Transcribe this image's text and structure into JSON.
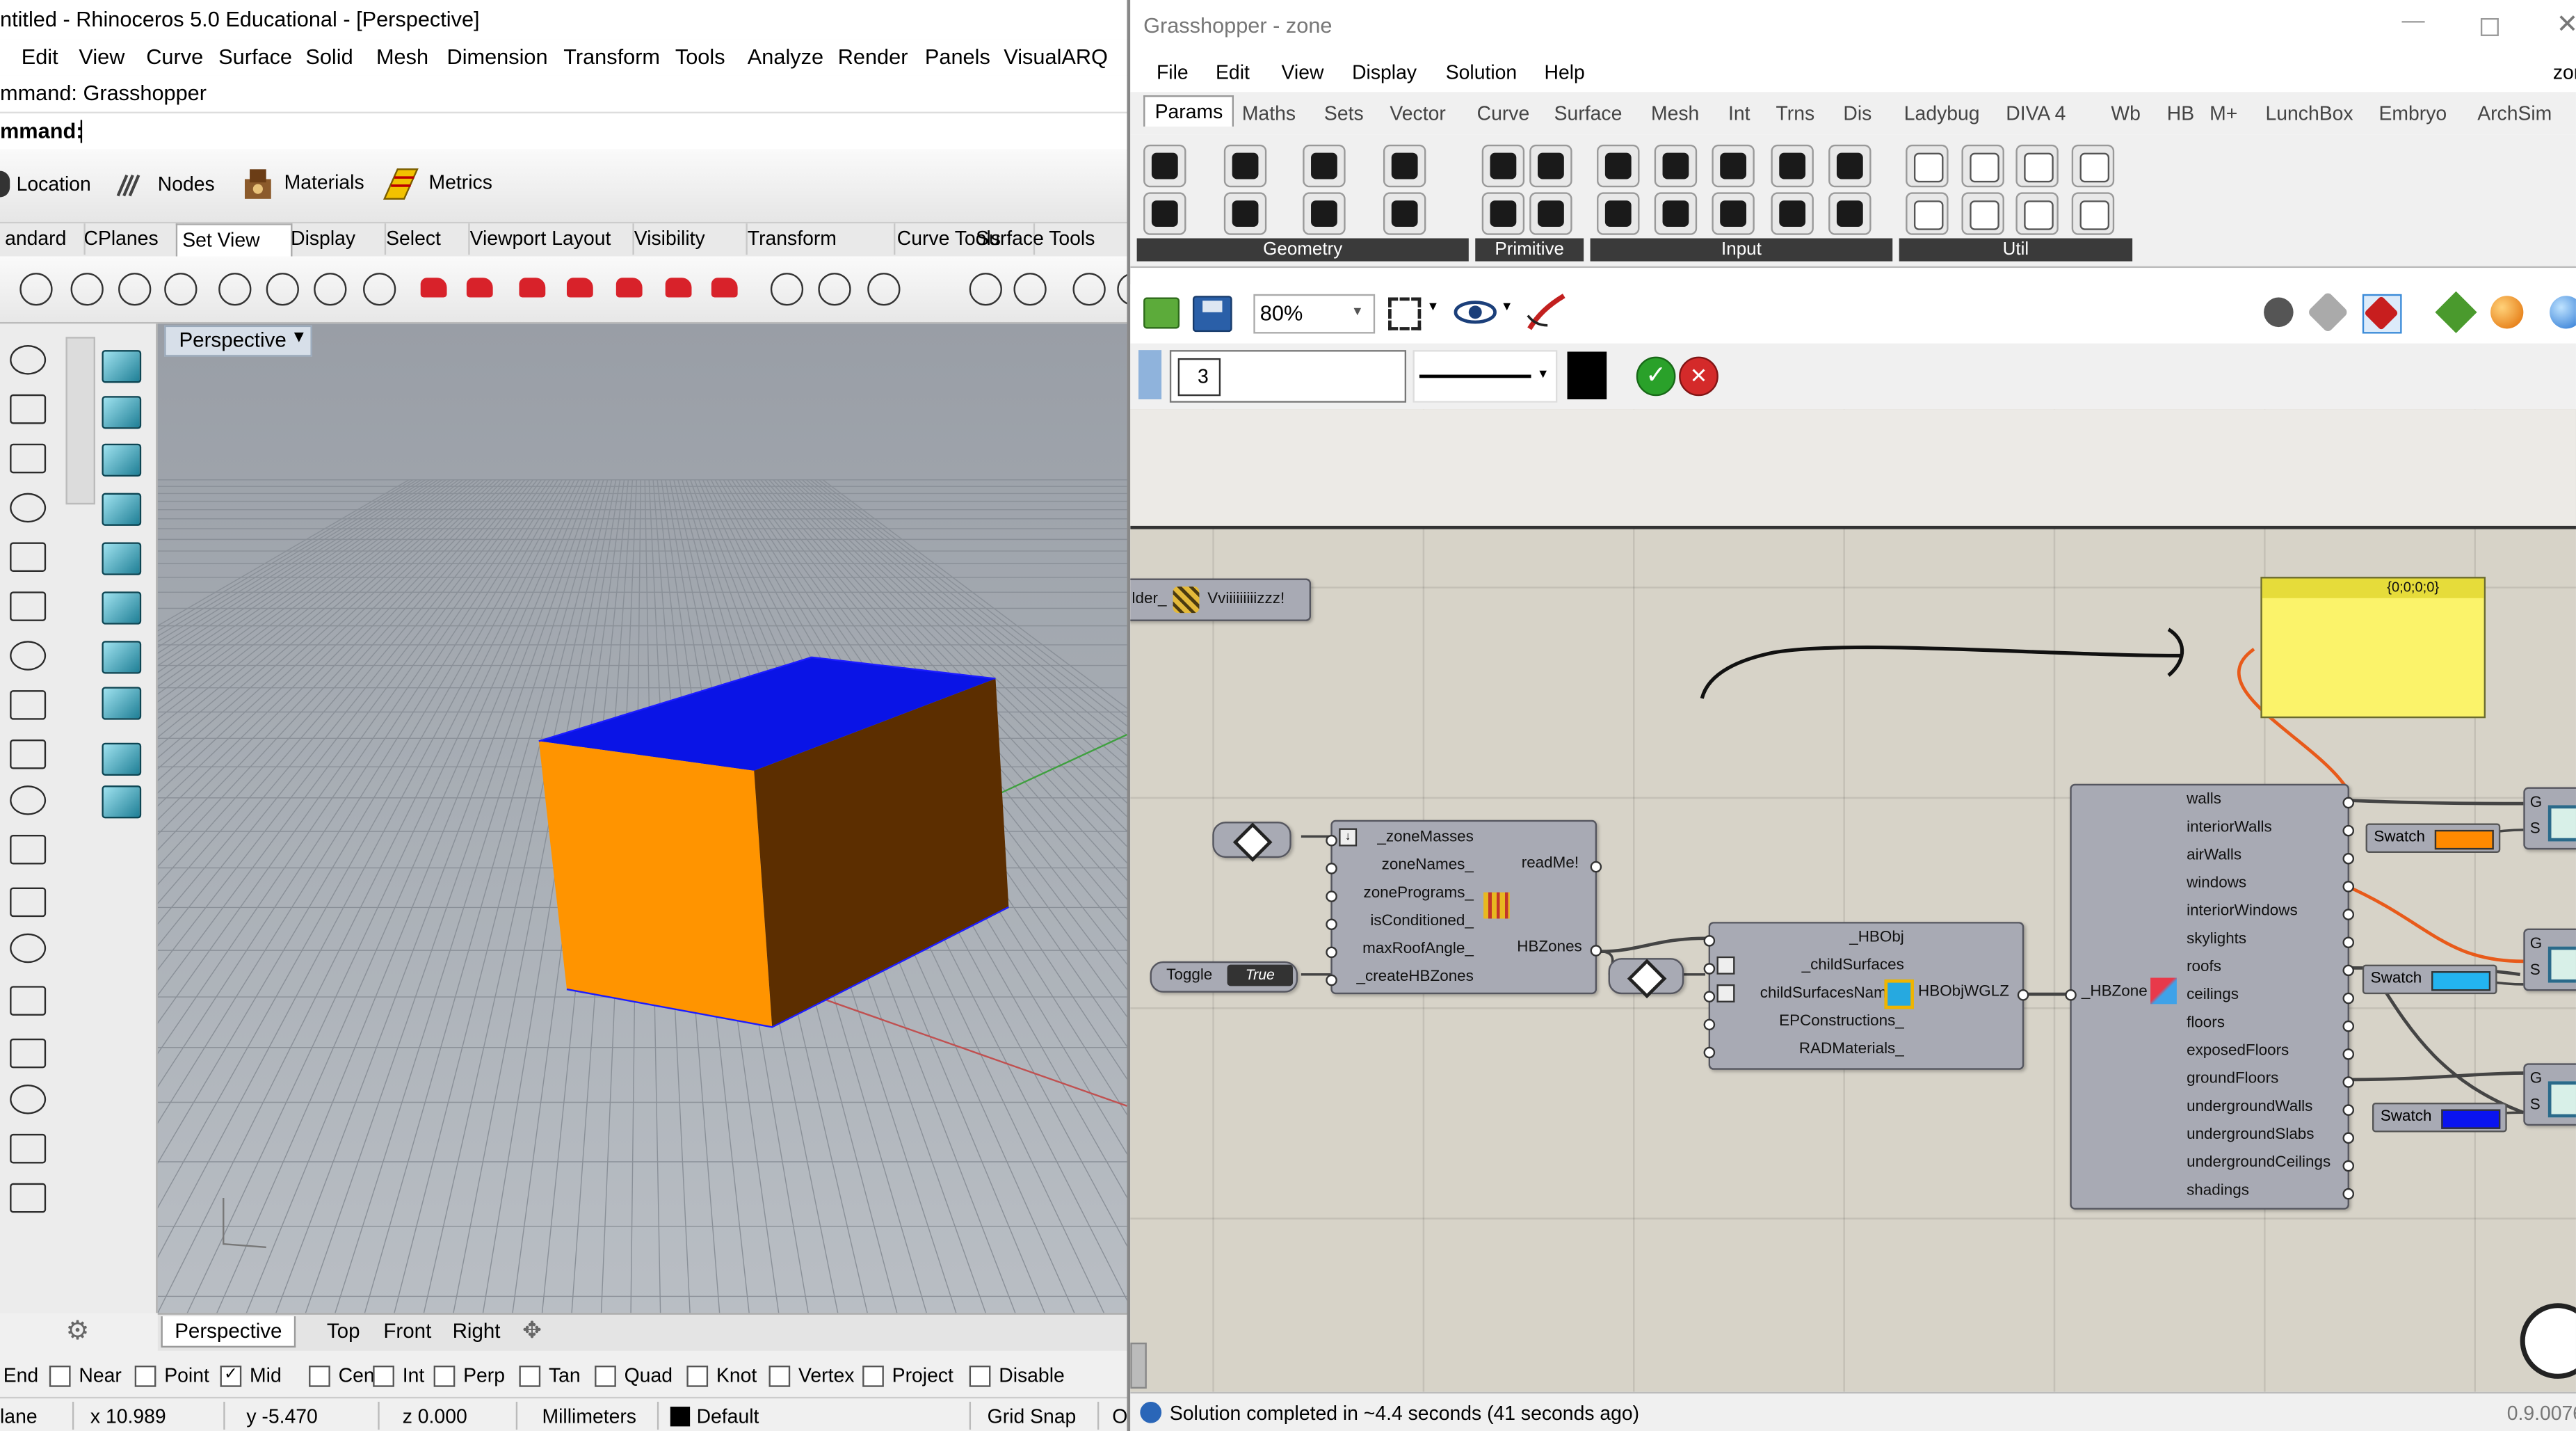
{
  "rhino": {
    "title": "ntitled - Rhinoceros 5.0 Educational - [Perspective]",
    "menu": [
      "Edit",
      "View",
      "Curve",
      "Surface",
      "Solid",
      "Mesh",
      "Dimension",
      "Transform",
      "Tools",
      "Analyze",
      "Render",
      "Panels",
      "VisualARQ"
    ],
    "command_history": "mmand: Grasshopper",
    "command_prompt": "mmand:",
    "toolbar_buttons": [
      "Location",
      "Nodes",
      "Materials",
      "Metrics"
    ],
    "tabs": [
      "andard",
      "CPlanes",
      "Set View",
      "Display",
      "Select",
      "Viewport Layout",
      "Visibility",
      "Transform",
      "Curve Tools",
      "Surface Tools"
    ],
    "active_tab": "Set View",
    "viewport_title": "Perspective",
    "viewport_tabs": [
      "Perspective",
      "Top",
      "Front",
      "Right"
    ],
    "osnaps": [
      {
        "label": "End",
        "checked": false
      },
      {
        "label": "Near",
        "checked": false
      },
      {
        "label": "Point",
        "checked": false
      },
      {
        "label": "Mid",
        "checked": true
      },
      {
        "label": "Cen",
        "checked": false
      },
      {
        "label": "Int",
        "checked": false
      },
      {
        "label": "Perp",
        "checked": false
      },
      {
        "label": "Tan",
        "checked": false
      },
      {
        "label": "Quad",
        "checked": false
      },
      {
        "label": "Knot",
        "checked": false
      },
      {
        "label": "Vertex",
        "checked": false
      },
      {
        "label": "Project",
        "checked": false
      },
      {
        "label": "Disable",
        "checked": false
      }
    ],
    "status": {
      "plane": "lane",
      "x": "x 10.989",
      "y": "y -5.470",
      "z": "z 0.000",
      "units": "Millimeters",
      "layer": "Default",
      "grid_snap": "Grid Snap",
      "ortho": "O"
    },
    "box_colors": {
      "top": "#0a14e6",
      "front": "#ff9400",
      "side": "#5c2e00",
      "edges": "#1c1cff"
    }
  },
  "grasshopper": {
    "title": "Grasshopper - zone",
    "menu": [
      "File",
      "Edit",
      "View",
      "Display",
      "Solution",
      "Help"
    ],
    "menu_right": "zor",
    "tabs": [
      "Params",
      "Maths",
      "Sets",
      "Vector",
      "Curve",
      "Surface",
      "Mesh",
      "Int",
      "Trns",
      "Dis",
      "Ladybug",
      "DIVA 4",
      "Wb",
      "HB",
      "M+",
      "LunchBox",
      "Embryo",
      "ArchSim"
    ],
    "active_tab": "Params",
    "panels": [
      "Geometry",
      "Primitive",
      "Input",
      "Util"
    ],
    "zoom": "80%",
    "pref_number": "3",
    "nodes": {
      "truncated_label": "lder_",
      "viz_label": "Vviiiiiiiiizzz!",
      "masses2zones_inputs": [
        "_zoneMasses",
        "zoneNames_",
        "zonePrograms_",
        "isConditioned_",
        "maxRoofAngle_",
        "_createHBZones"
      ],
      "masses2zones_outputs": [
        "readMe!",
        "HBZones"
      ],
      "toggle_label": "Toggle",
      "toggle_value": "True",
      "addsurf_inputs": [
        "_HBObj",
        "_childSurfaces",
        "childSurfacesName_",
        "EPConstructions_",
        "RADMaterials_"
      ],
      "addsurf_output": "HBObjWGLZ",
      "decompose_input": "_HBZone",
      "decompose_outputs": [
        "walls",
        "interiorWalls",
        "airWalls",
        "windows",
        "interiorWindows",
        "skylights",
        "roofs",
        "ceilings",
        "floors",
        "exposedFloors",
        "groundFloors",
        "undergroundWalls",
        "undergroundSlabs",
        "undergroundCeilings",
        "shadings"
      ],
      "panel_text": "{0;0;0;0}",
      "swatch_label": "Swatch",
      "swatches": [
        "#ff8a00",
        "#23b4f0",
        "#0a14f0"
      ],
      "preview_labels": [
        "G",
        "S"
      ]
    },
    "status": "Solution completed in ~4.4 seconds (41 seconds ago)",
    "version": "0.9.0076"
  }
}
